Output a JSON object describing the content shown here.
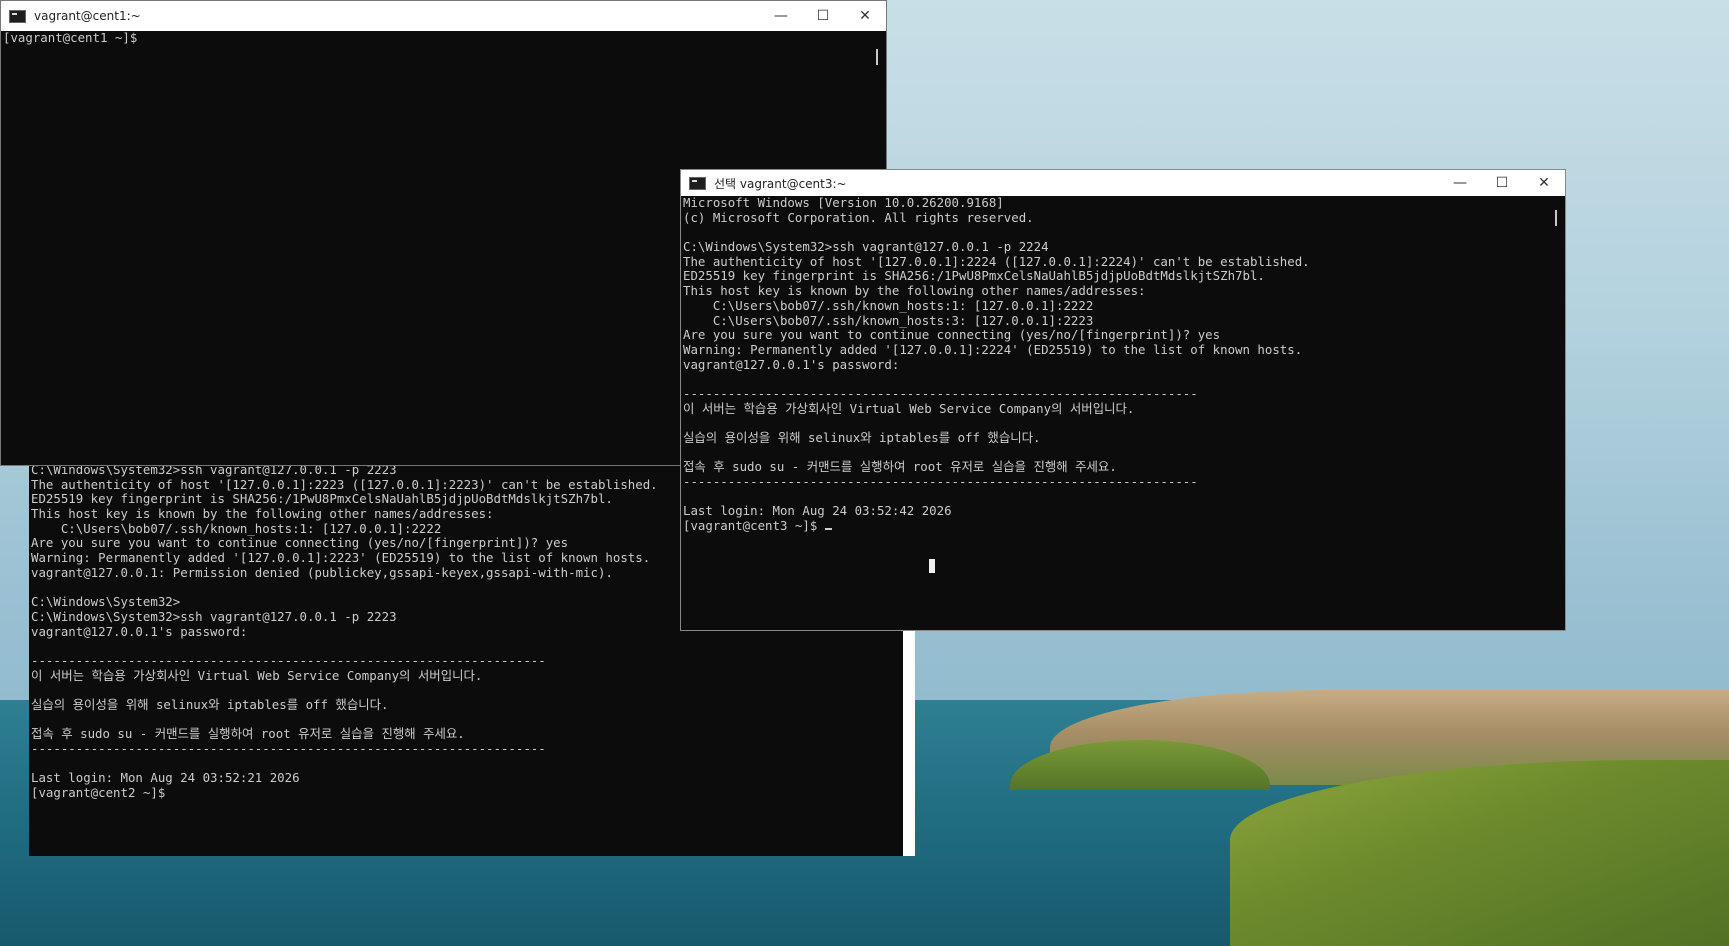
{
  "windows": {
    "cent1": {
      "title": "vagrant@cent1:~",
      "lines": [
        "[vagrant@cent1 ~]$"
      ]
    },
    "cent2": {
      "lines": [
        "C:\\Windows\\System32>ssh vagrant@127.0.0.1 -p 2223",
        "The authenticity of host '[127.0.0.1]:2223 ([127.0.0.1]:2223)' can't be established.",
        "ED25519 key fingerprint is SHA256:/1PwU8PmxCelsNaUahlB5jdjpUoBdtMdslkjtSZh7bl.",
        "This host key is known by the following other names/addresses:",
        "    C:\\Users\\bob07/.ssh/known_hosts:1: [127.0.0.1]:2222",
        "Are you sure you want to continue connecting (yes/no/[fingerprint])? yes",
        "Warning: Permanently added '[127.0.0.1]:2223' (ED25519) to the list of known hosts.",
        "vagrant@127.0.0.1: Permission denied (publickey,gssapi-keyex,gssapi-with-mic).",
        "",
        "C:\\Windows\\System32>",
        "C:\\Windows\\System32>ssh vagrant@127.0.0.1 -p 2223",
        "vagrant@127.0.0.1's password:",
        "",
        "---------------------------------------------------------------------",
        "이 서버는 학습용 가상회사인 Virtual Web Service Company의 서버입니다.",
        "",
        "실습의 용이성을 위해 selinux와 iptables를 off 했습니다.",
        "",
        "접속 후 sudo su - 커맨드를 실행하여 root 유저로 실습을 진행해 주세요.",
        "---------------------------------------------------------------------",
        "",
        "Last login: Mon Aug 24 03:52:21 2026",
        "[vagrant@cent2 ~]$"
      ]
    },
    "cent3": {
      "title": "선택 vagrant@cent3:~",
      "lines": [
        "Microsoft Windows [Version 10.0.26200.9168]",
        "(c) Microsoft Corporation. All rights reserved.",
        "",
        "C:\\Windows\\System32>ssh vagrant@127.0.0.1 -p 2224",
        "The authenticity of host '[127.0.0.1]:2224 ([127.0.0.1]:2224)' can't be established.",
        "ED25519 key fingerprint is SHA256:/1PwU8PmxCelsNaUahlB5jdjpUoBdtMdslkjtSZh7bl.",
        "This host key is known by the following other names/addresses:",
        "    C:\\Users\\bob07/.ssh/known_hosts:1: [127.0.0.1]:2222",
        "    C:\\Users\\bob07/.ssh/known_hosts:3: [127.0.0.1]:2223",
        "Are you sure you want to continue connecting (yes/no/[fingerprint])? yes",
        "Warning: Permanently added '[127.0.0.1]:2224' (ED25519) to the list of known hosts.",
        "vagrant@127.0.0.1's password:",
        "",
        "---------------------------------------------------------------------",
        "이 서버는 학습용 가상회사인 Virtual Web Service Company의 서버입니다.",
        "",
        "실습의 용이성을 위해 selinux와 iptables를 off 했습니다.",
        "",
        "접속 후 sudo su - 커맨드를 실행하여 root 유저로 실습을 진행해 주세요.",
        "---------------------------------------------------------------------",
        "",
        "Last login: Mon Aug 24 03:52:42 2026",
        "[vagrant@cent3 ~]$ "
      ]
    }
  },
  "controls": {
    "minimize": "—",
    "maximize": "☐",
    "close": "✕"
  }
}
